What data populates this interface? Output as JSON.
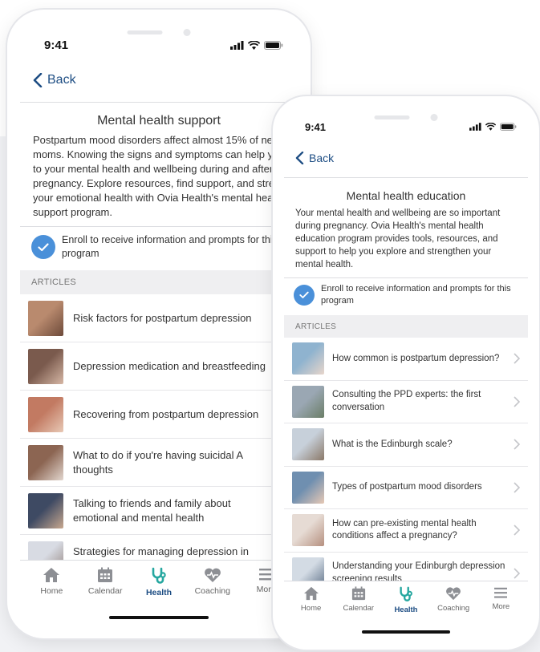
{
  "colors": {
    "accent": "#1d4d83",
    "check": "#4a90d9",
    "health_tab": "#26a7a0"
  },
  "phone_left": {
    "status": {
      "time": "9:41"
    },
    "nav": {
      "back_label": "Back"
    },
    "title": "Mental health support",
    "description": "Postpartum mood disorders affect almost 15% of new moms. Knowing the signs and symptoms can help you tend to your mental health and wellbeing during and after pregnancy. Explore resources, find support, and strengthen your emotional health with Ovia Health's mental health support program.",
    "enroll_text": "Enroll to receive information and prompts for this program",
    "articles_header": "ARTICLES",
    "articles": [
      {
        "title": "Risk factors for postpartum depression",
        "thumb": [
          "#b98a6e",
          "#6d4a3a"
        ]
      },
      {
        "title": "Depression medication and breastfeeding",
        "thumb": [
          "#7a5a4d",
          "#d7b8a6"
        ]
      },
      {
        "title": "Recovering from postpartum depression",
        "thumb": [
          "#c27a62",
          "#e8c9b6"
        ]
      },
      {
        "title": "What to do if you're having suicidal A thoughts",
        "thumb": [
          "#8c6552",
          "#e3d7cf"
        ]
      },
      {
        "title": "Talking to friends and family about emotional and mental health",
        "thumb": [
          "#3e4a63",
          "#c8a88f"
        ]
      },
      {
        "title": "Strategies for managing depression in pregnancy and postpartum",
        "thumb": [
          "#d8dbe3",
          "#8f7f7a"
        ]
      }
    ],
    "tabs": [
      {
        "label": "Home",
        "icon": "home-icon"
      },
      {
        "label": "Calendar",
        "icon": "calendar-icon"
      },
      {
        "label": "Health",
        "icon": "stethoscope-icon"
      },
      {
        "label": "Coaching",
        "icon": "heart-pulse-icon"
      },
      {
        "label": "More",
        "icon": "menu-icon"
      }
    ]
  },
  "phone_right": {
    "status": {
      "time": "9:41"
    },
    "nav": {
      "back_label": "Back"
    },
    "title": "Mental health education",
    "description": "Your mental health and wellbeing are so important during pregnancy. Ovia Health's mental health education program provides tools, resources, and support to help you explore and strengthen your mental health.",
    "enroll_text": "Enroll to receive information and prompts for this program",
    "articles_header": "ARTICLES",
    "articles": [
      {
        "title": "How common is postpartum depression?",
        "thumb": [
          "#8fb3cf",
          "#e9d6cb"
        ]
      },
      {
        "title": "Consulting the PPD experts: the first conversation",
        "thumb": [
          "#9aa7b3",
          "#6a7d66"
        ]
      },
      {
        "title": "What is the Edinburgh scale?",
        "thumb": [
          "#c7d0da",
          "#8a7868"
        ]
      },
      {
        "title": "Types of postpartum mood disorders",
        "thumb": [
          "#6f8fb0",
          "#e7c9b5"
        ]
      },
      {
        "title": "How can pre-existing mental health conditions affect a pregnancy?",
        "thumb": [
          "#e6dbd4",
          "#b58f7e"
        ]
      },
      {
        "title": "Understanding your Edinburgh depression screening results",
        "thumb": [
          "#d3dbe4",
          "#5c6f86"
        ]
      }
    ],
    "tabs": [
      {
        "label": "Home",
        "icon": "home-icon"
      },
      {
        "label": "Calendar",
        "icon": "calendar-icon"
      },
      {
        "label": "Health",
        "icon": "stethoscope-icon"
      },
      {
        "label": "Coaching",
        "icon": "heart-pulse-icon"
      },
      {
        "label": "More",
        "icon": "menu-icon"
      }
    ]
  }
}
